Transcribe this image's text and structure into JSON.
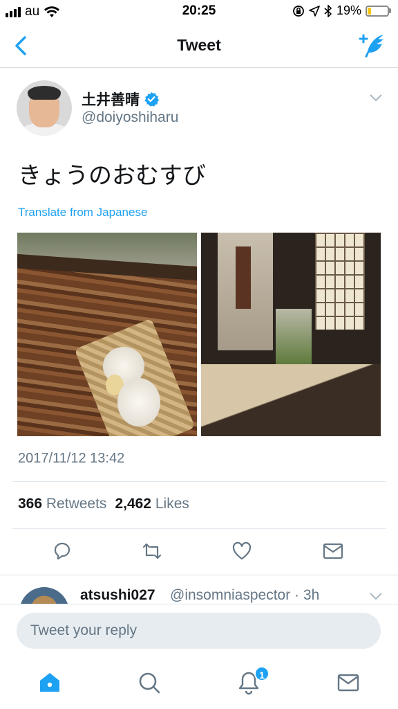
{
  "status_bar": {
    "carrier": "au",
    "time": "20:25",
    "battery": "19%",
    "battery_level": 0.19
  },
  "nav": {
    "title": "Tweet"
  },
  "tweet": {
    "display_name": "土井善晴",
    "handle": "@doiyoshiharu",
    "text": "きょうのおむすび",
    "translate_label": "Translate from Japanese",
    "timestamp": "2017/11/12 13:42",
    "retweets_count": "366",
    "retweets_label": "Retweets",
    "likes_count": "2,462",
    "likes_label": "Likes"
  },
  "reply_preview": {
    "name": "atsushi027",
    "handle": "@insomniaspector · 3h"
  },
  "compose": {
    "placeholder": "Tweet your reply"
  },
  "tab_bar": {
    "notification_count": "1"
  },
  "colors": {
    "accent": "#1da1f2",
    "secondary_text": "#657786"
  }
}
